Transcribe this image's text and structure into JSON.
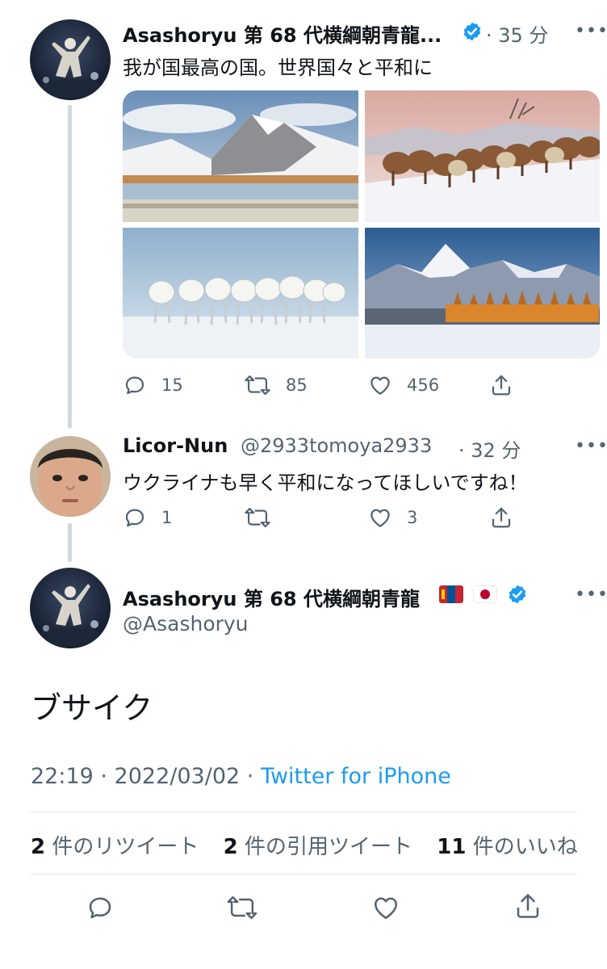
{
  "tweet1": {
    "display_name": "Asashoryu 第 68 代横綱朝青龍...",
    "age": "· 35 分",
    "text": "我が国最高の国。世界国々と平和に",
    "replies": "15",
    "retweets": "85",
    "likes": "456"
  },
  "tweet2": {
    "display_name": "Licor-Nun",
    "handle": "@2933tomoya2933",
    "age": "· 32 分",
    "text": "ウクライナも早く平和になってほしいですね！",
    "replies": "1",
    "likes": "3"
  },
  "main_tweet": {
    "display_name": "Asashoryu 第 68 代横綱朝青龍",
    "handle": "@Asashoryu",
    "text": "ブサイク",
    "time": "22:19 · 2022/03/02 ·",
    "source": "Twitter for iPhone",
    "retweet_count": "2",
    "retweet_label": "件のリツイート",
    "quote_count": "2",
    "quote_label": "件の引用ツイート",
    "like_count": "11",
    "like_label": "件のいいね"
  },
  "colors": {
    "verified": "#1d9bf0",
    "link": "#1d9bf0",
    "secondary_text": "#536471"
  },
  "icons": [
    "reply-icon",
    "retweet-icon",
    "like-icon",
    "share-icon",
    "verified-icon",
    "more-icon",
    "mongolia-flag-icon",
    "japan-flag-icon"
  ]
}
